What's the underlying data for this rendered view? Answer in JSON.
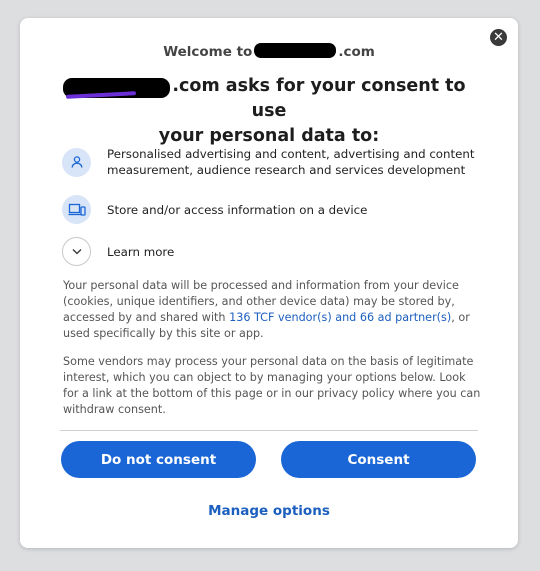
{
  "dialog": {
    "close_glyph": "✕",
    "welcome_prefix": "Welcome to",
    "welcome_suffix": ".com",
    "heading_line1_suffix": ".com asks for your consent to use",
    "heading_line2": "your personal data to:",
    "purposes": [
      {
        "icon": "person-icon",
        "label": "Personalised advertising and content, advertising and content measurement, audience research and services development"
      },
      {
        "icon": "devices-icon",
        "label": "Store and/or access information on a device"
      }
    ],
    "learn_more": "Learn more",
    "paragraph1_start": "Your personal data will be processed and information from your device (cookies, unique identifiers, and other device data) may be stored by, accessed by and shared with ",
    "paragraph1_link": "136 TCF vendor(s) and 66 ad partner(s)",
    "paragraph1_end": ", or used specifically by this site or app.",
    "paragraph2": "Some vendors may process your personal data on the basis of legitimate interest, which you can object to by managing your options below. Look for a link at the bottom of this page or in our privacy policy where you can withdraw consent.",
    "do_not_consent": "Do not consent",
    "consent": "Consent",
    "manage_options": "Manage options"
  },
  "colors": {
    "accent": "#1a66d6",
    "link": "#1c5fbf",
    "icon_bg": "#d8e4f7"
  }
}
